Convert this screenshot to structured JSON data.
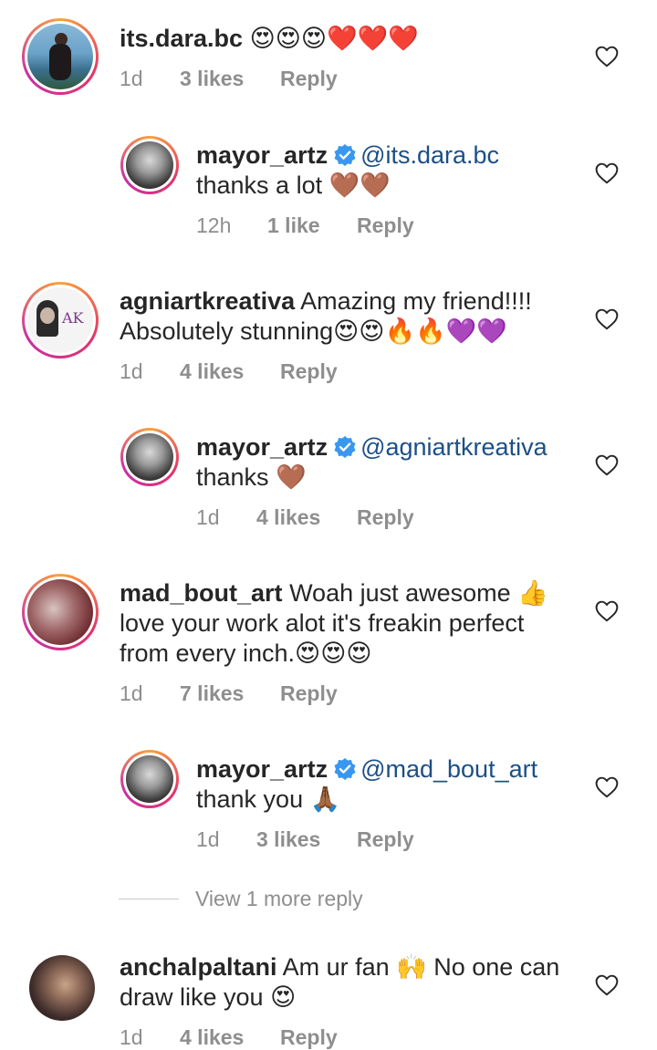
{
  "comments": [
    {
      "username": "its.dara.bc",
      "text": "",
      "emojis": "😍😍😍❤️❤️❤️",
      "time": "1d",
      "likes": "3 likes",
      "reply": "Reply"
    },
    {
      "username": "mayor_artz",
      "mention": "@its.dara.bc",
      "text": "thanks a lot",
      "emojis": "🤎🤎",
      "time": "12h",
      "likes": "1 like",
      "reply": "Reply"
    },
    {
      "username": "agniartkreativa",
      "text_line1": "Amazing my friend!!!!",
      "text_line2": "Absolutely stunning",
      "emojis": "😍😍🔥🔥💜💜",
      "time": "1d",
      "likes": "4 likes",
      "reply": "Reply"
    },
    {
      "username": "mayor_artz",
      "mention": "@agniartkreativa",
      "text": "thanks",
      "emojis": "🤎",
      "time": "1d",
      "likes": "4 likes",
      "reply": "Reply"
    },
    {
      "username": "mad_bout_art",
      "text_line1": "Woah just awesome 👍",
      "text_line2": "love your work alot it's freakin perfect",
      "text_line3": "from every inch.😍😍😍",
      "time": "1d",
      "likes": "7 likes",
      "reply": "Reply"
    },
    {
      "username": "mayor_artz",
      "mention": "@mad_bout_art",
      "text": "thank you 🙏🏾",
      "time": "1d",
      "likes": "3 likes",
      "reply": "Reply"
    },
    {
      "username": "anchalpaltani",
      "text_line1": "Am ur fan 🙌 No one can",
      "text_line2": "draw like you 😍",
      "time": "1d",
      "likes": "4 likes",
      "reply": "Reply"
    }
  ],
  "view_more": "View 1 more reply",
  "icons": {
    "like": "heart-outline-icon",
    "verified": "verified-badge-icon"
  },
  "colors": {
    "mention": "#1c4f86",
    "verified": "#3897f0",
    "meta": "#8e8e8e"
  }
}
